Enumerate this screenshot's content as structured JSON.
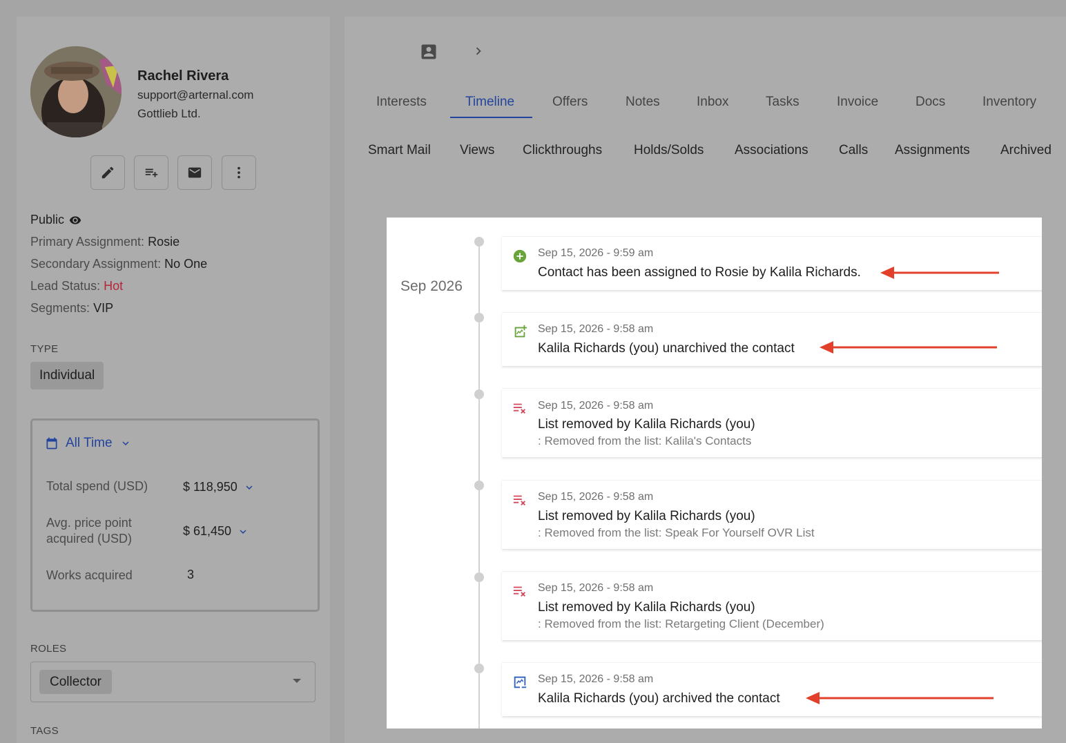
{
  "contact": {
    "name": "Rachel Rivera",
    "email": "support@arternal.com",
    "company": "Gottlieb Ltd."
  },
  "actions": [
    "pencil-icon",
    "playlist-add-icon",
    "mail-icon",
    "more-vert-icon"
  ],
  "visibility": "Public",
  "details": [
    {
      "key": "Primary Assignment:",
      "value": "Rosie"
    },
    {
      "key": "Secondary Assignment:",
      "value": "No One"
    },
    {
      "key": "Lead Status:",
      "value": "Hot"
    },
    {
      "key": "Segments:",
      "value": "VIP"
    }
  ],
  "type": {
    "label": "TYPE",
    "value": "Individual"
  },
  "stats": {
    "range": "All Time",
    "rows": [
      {
        "label": "Total spend (USD)",
        "value": "$ 118,950"
      },
      {
        "label": "Avg. price point acquired (USD)",
        "value": "$ 61,450"
      },
      {
        "label": "Works acquired",
        "value": "3"
      }
    ]
  },
  "roles": {
    "label": "ROLES",
    "value": "Collector"
  },
  "tags": {
    "label": "TAGS"
  },
  "tabs_primary": [
    "Interests",
    "Timeline",
    "Offers",
    "Notes",
    "Inbox",
    "Tasks",
    "Invoice",
    "Docs",
    "Inventory"
  ],
  "active_tab": "Timeline",
  "tabs_secondary": [
    "Smart Mail",
    "Views",
    "Clickthroughs",
    "Holds/Solds",
    "Associations",
    "Calls",
    "Assignments",
    "Archived"
  ],
  "timeline": {
    "month": "Sep 2026",
    "entries": [
      {
        "date": "Sep 15, 2026 - 9:59 am",
        "title": "Contact has been assigned to Rosie by Kalila Richards.",
        "sub": "",
        "icon": "add-circle-icon",
        "color": "#6aa33c"
      },
      {
        "date": "Sep 15, 2026 - 9:58 am",
        "title": "Kalila Richards (you) unarchived the contact",
        "sub": "",
        "icon": "unarchive-icon",
        "color": "#6aa33c"
      },
      {
        "date": "Sep 15, 2026 - 9:58 am",
        "title": "List removed by  Kalila Richards  (you)",
        "sub": ": Removed from the list: Kalila's Contacts",
        "icon": "list-remove-icon",
        "color": "#d4485c"
      },
      {
        "date": "Sep 15, 2026 - 9:58 am",
        "title": "List removed by  Kalila Richards  (you)",
        "sub": ": Removed from the list: Speak For Yourself OVR List",
        "icon": "list-remove-icon",
        "color": "#d4485c"
      },
      {
        "date": "Sep 15, 2026 - 9:58 am",
        "title": "List removed by  Kalila Richards  (you)",
        "sub": ": Removed from the list: Retargeting Client (December)",
        "icon": "list-remove-icon",
        "color": "#d4485c"
      },
      {
        "date": "Sep 15, 2026 - 9:58 am",
        "title": "Kalila Richards (you) archived the contact",
        "sub": "",
        "icon": "archive-icon",
        "color": "#2d5fbf"
      }
    ]
  },
  "colors": {
    "accent": "#23449c",
    "hot": "#b5263b",
    "arrow": "#e2402b"
  }
}
